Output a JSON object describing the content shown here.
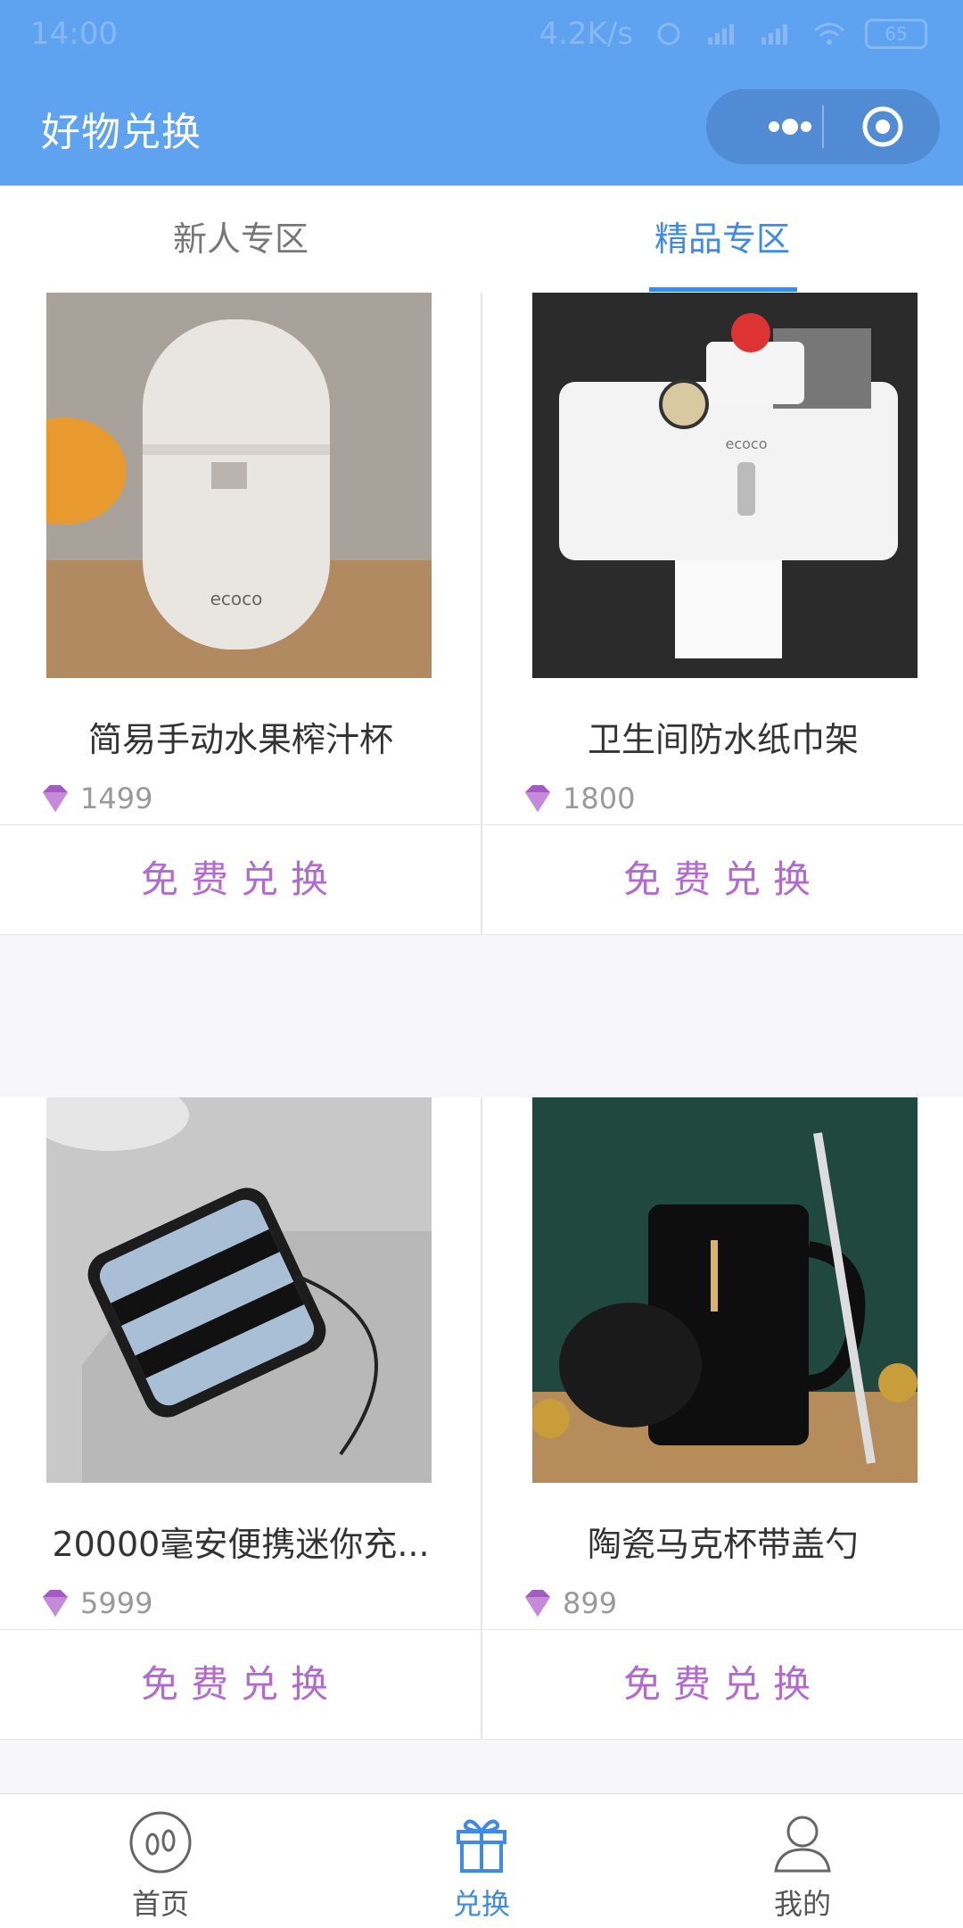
{
  "status_bar": {
    "time": "14:00",
    "speed": "4.2K/s",
    "battery": "65"
  },
  "header": {
    "title": "好物兑换"
  },
  "tabs": [
    {
      "label": "新人专区",
      "active": false
    },
    {
      "label": "精品专区",
      "active": true
    }
  ],
  "products": [
    {
      "name": "简易手动水果榨汁杯",
      "points": "1499",
      "button": "免费兑换"
    },
    {
      "name": "卫生间防水纸巾架",
      "points": "1800",
      "button": "免费兑换"
    },
    {
      "name": "20000毫安便携迷你充...",
      "points": "5999",
      "button": "免费兑换"
    },
    {
      "name": "陶瓷马克杯带盖勺",
      "points": "899",
      "button": "免费兑换"
    }
  ],
  "bottom_nav": [
    {
      "label": "首页",
      "icon": "footprints-icon",
      "active": false
    },
    {
      "label": "兑换",
      "icon": "gift-icon",
      "active": true
    },
    {
      "label": "我的",
      "icon": "user-icon",
      "active": false
    }
  ],
  "colors": {
    "header": "#5ea2f0",
    "active_tab": "#3d8be6",
    "button_text": "#b36ad0"
  }
}
